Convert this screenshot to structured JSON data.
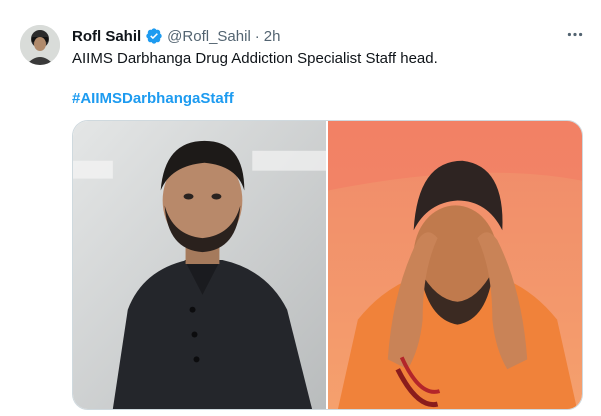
{
  "tweet": {
    "author_name": "Rofl Sahil",
    "handle": "@Rofl_Sahil",
    "separator": "·",
    "time": "2h",
    "more_label": "···",
    "text": "AIIMS Darbhanga Drug Addiction Specialist Staff head.",
    "hashtag": "#AIIMSDarbhangaStaff"
  },
  "colors": {
    "verified_badge": "#1d9bf0",
    "hashtag": "#1d9bf0",
    "secondary_text": "#536471"
  },
  "icons": {
    "verified": "verified-badge-icon",
    "more": "more-options-icon"
  }
}
